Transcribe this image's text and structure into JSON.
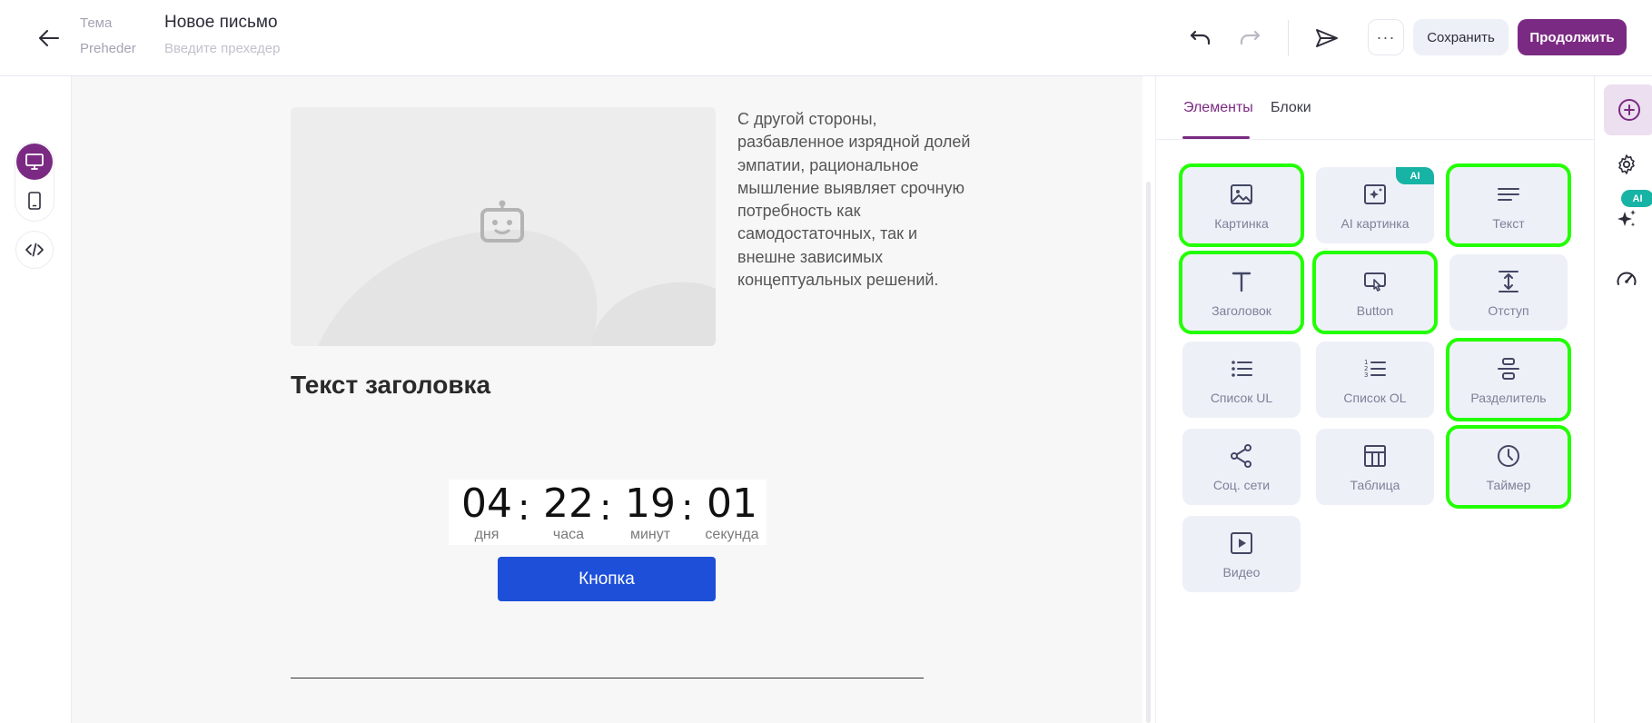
{
  "header": {
    "subject_label": "Тема",
    "preheader_label": "Preheder",
    "subject_value": "Новое письмо",
    "preheader_placeholder": "Введите прехедер",
    "save_label": "Сохранить",
    "continue_label": "Продолжить",
    "more_label": "···"
  },
  "canvas": {
    "paragraph": "С другой стороны, разбавленное изрядной долей эмпатии, рациональное мышление выявляет срочную потребность как самодостаточных, так и внешне зависимых концептуальных решений.",
    "heading": "Текст заголовка",
    "timer": {
      "days": "04",
      "days_label": "дня",
      "hours": "22",
      "hours_label": "часа",
      "minutes": "19",
      "minutes_label": "минут",
      "seconds": "01",
      "seconds_label": "секунда",
      "separator": ":"
    },
    "button_label": "Кнопка"
  },
  "panel": {
    "tabs": [
      {
        "label": "Элементы",
        "active": true
      },
      {
        "label": "Блоки",
        "active": false
      }
    ],
    "ai_badge": "AI",
    "tiles": [
      {
        "label": "Картинка",
        "icon": "image-icon",
        "highlighted": true
      },
      {
        "label": "AI картинка",
        "icon": "ai-image-icon",
        "highlighted": false,
        "badge": "AI"
      },
      {
        "label": "Текст",
        "icon": "text-icon",
        "highlighted": true
      },
      {
        "label": "Заголовок",
        "icon": "heading-icon",
        "highlighted": true
      },
      {
        "label": "Button",
        "icon": "button-icon",
        "highlighted": true
      },
      {
        "label": "Отступ",
        "icon": "spacer-icon",
        "highlighted": false
      },
      {
        "label": "Список UL",
        "icon": "bullet-list-icon",
        "highlighted": false
      },
      {
        "label": "Список OL",
        "icon": "numbered-list-icon",
        "highlighted": false
      },
      {
        "label": "Разделитель",
        "icon": "divider-icon",
        "highlighted": true
      },
      {
        "label": "Соц. сети",
        "icon": "share-icon",
        "highlighted": false
      },
      {
        "label": "Таблица",
        "icon": "table-icon",
        "highlighted": false
      },
      {
        "label": "Таймер",
        "icon": "clock-icon",
        "highlighted": true
      },
      {
        "label": "Видео",
        "icon": "video-icon",
        "highlighted": false
      }
    ]
  },
  "rail": {
    "ai_badge": "AI"
  },
  "colors": {
    "brand": "#7b2a83",
    "cta_blue": "#1d4fd8",
    "ai_teal": "#17b3a5",
    "highlight_green": "#22ff00",
    "tile_bg": "#eef0f8"
  }
}
